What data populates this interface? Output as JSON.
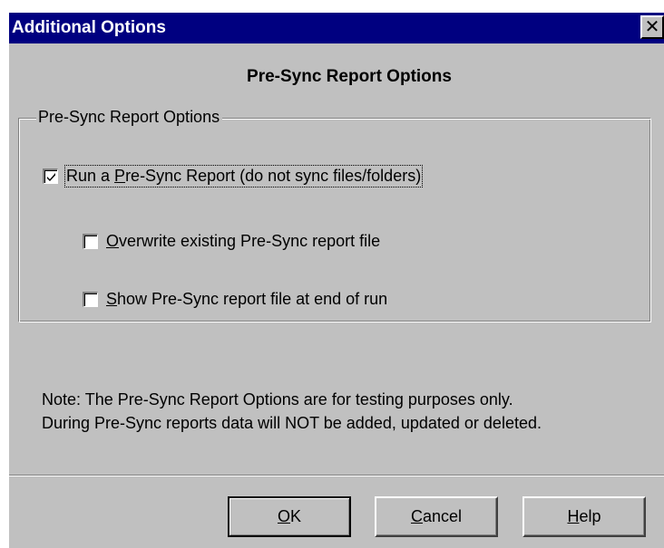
{
  "dialog": {
    "title": "Additional Options",
    "close_glyph": "✕",
    "heading": "Pre-Sync Report Options"
  },
  "group": {
    "legend": "Pre-Sync Report Options",
    "options": [
      {
        "pre": "Run a ",
        "key": "P",
        "post": "re-Sync Report (do not sync files/folders)",
        "checked": true
      },
      {
        "pre": "",
        "key": "O",
        "post": "verwrite existing Pre-Sync report file",
        "checked": false
      },
      {
        "pre": "",
        "key": "S",
        "post": "how Pre-Sync report file at end of run",
        "checked": false
      }
    ]
  },
  "note": {
    "line1": "Note: The Pre-Sync Report Options are for testing purposes only.",
    "line2": "During Pre-Sync reports data will NOT be added, updated or deleted."
  },
  "buttons": {
    "ok": {
      "key": "O",
      "rest": "K"
    },
    "cancel": {
      "key": "C",
      "rest": "ancel"
    },
    "help": {
      "key": "H",
      "rest": "elp"
    }
  },
  "colors": {
    "titlebar": "#000080",
    "face": "#c0c0c0"
  }
}
